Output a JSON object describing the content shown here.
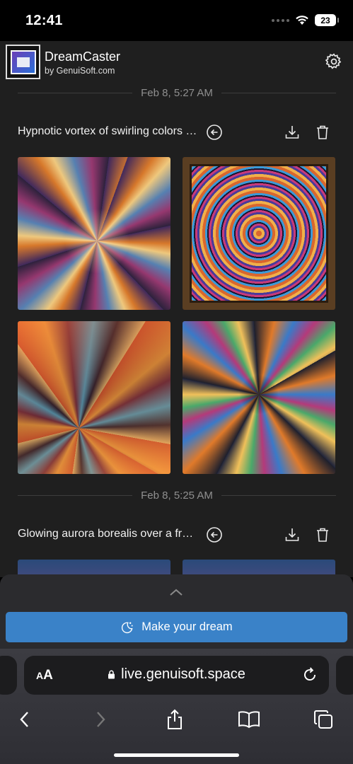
{
  "status_bar": {
    "time": "12:41",
    "battery": "23"
  },
  "app": {
    "title": "DreamCaster",
    "subtitle": "by GenuiSoft.com"
  },
  "feed": [
    {
      "date": "Feb 8, 5:27 AM",
      "prompt": "Hypnotic vortex of swirling colors and shapes"
    },
    {
      "date": "Feb 8, 5:25 AM",
      "prompt": "Glowing aurora borealis over a frozen landscape"
    }
  ],
  "actions": {
    "make_dream": "Make your dream"
  },
  "browser": {
    "aa_big": "A",
    "aa_small": "A",
    "url": "live.genuisoft.space"
  },
  "colors": {
    "accent": "#3a82c8",
    "background": "#1f1f1f",
    "sheet": "#2b2b2e"
  }
}
